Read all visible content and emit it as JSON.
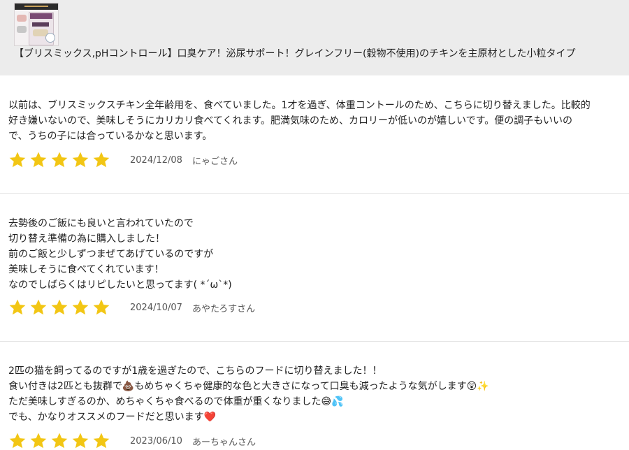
{
  "product": {
    "thumbnail_icon": "product-package-icon",
    "title": "【ブリスミックス,pHコントロール】口臭ケア！泌尿サポート！グレインフリー(穀物不使用)のチキンを主原材とした小粒タイプ"
  },
  "colors": {
    "star": "#f2c614",
    "header_bg": "#ececec",
    "divider": "#e3e3e3"
  },
  "reviews": [
    {
      "lines": [
        "以前は、ブリスミックスチキン全年齢用を、食べていました。1才を過ぎ、体重コントールのため、こちらに切り替えました。比較的",
        "好き嫌いないので、美味しそうにカリカリ食べてくれます。肥満気味のため、カロリーが低いのが嬉しいです。便の調子もいいの",
        "で、うちの子には合っているかなと思います。"
      ],
      "rating": 5,
      "date": "2024/12/08",
      "author": "にゃごさん"
    },
    {
      "lines": [
        "去勢後のご飯にも良いと言われていたので",
        "切り替え準備の為に購入しました！",
        "前のご飯と少しずつまぜてあげているのですが",
        "美味しそうに食べてくれています！",
        "なのでしばらくはリピしたいと思ってます( *´ω`*)"
      ],
      "rating": 5,
      "date": "2024/10/07",
      "author": "あやたろすさん"
    },
    {
      "lines": [
        "2匹の猫を飼ってるのですが1歳を過ぎたので、こちらのフードに切り替えました！！",
        "食い付きは2匹とも抜群で💩もめちゃくちゃ健康的な色と大きさになって口臭も減ったような気がします😲✨",
        "ただ美味しすぎるのか、めちゃくちゃ食べるので体重が重くなりました😅💦",
        "でも、かなりオススメのフードだと思います❤️"
      ],
      "rating": 5,
      "date": "2023/06/10",
      "author": "あーちゃんさん"
    }
  ]
}
